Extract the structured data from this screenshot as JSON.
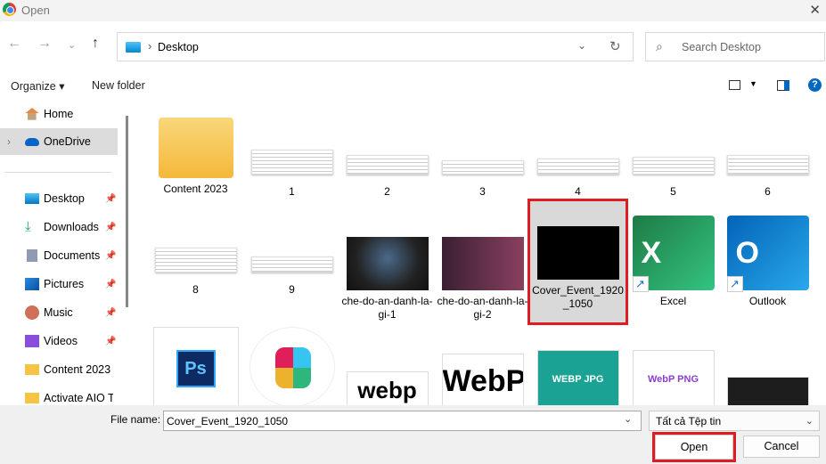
{
  "window": {
    "title": "Open"
  },
  "address": {
    "path": "Desktop",
    "search_placeholder": "Search Desktop"
  },
  "toolbar": {
    "organize": "Organize ▾",
    "new_folder": "New folder"
  },
  "sidebar": {
    "items": [
      {
        "label": "Home",
        "icon": "home-icon"
      },
      {
        "label": "OneDrive",
        "icon": "cloud-icon",
        "selected": true
      },
      {
        "label": "Desktop",
        "icon": "desktop-icon",
        "pinned": true
      },
      {
        "label": "Downloads",
        "icon": "download-icon",
        "pinned": true
      },
      {
        "label": "Documents",
        "icon": "document-icon",
        "pinned": true
      },
      {
        "label": "Pictures",
        "icon": "pictures-icon",
        "pinned": true
      },
      {
        "label": "Music",
        "icon": "music-icon",
        "pinned": true
      },
      {
        "label": "Videos",
        "icon": "videos-icon",
        "pinned": true
      },
      {
        "label": "Content 2023",
        "icon": "folder-icon"
      },
      {
        "label": "Activate AIO Too",
        "icon": "folder-icon"
      }
    ]
  },
  "files": [
    {
      "name": "Content 2023",
      "type": "folder"
    },
    {
      "name": "1",
      "type": "doc"
    },
    {
      "name": "2",
      "type": "doc"
    },
    {
      "name": "3",
      "type": "doc"
    },
    {
      "name": "4",
      "type": "doc"
    },
    {
      "name": "5",
      "type": "doc"
    },
    {
      "name": "6",
      "type": "doc"
    },
    {
      "name": "8",
      "type": "doc"
    },
    {
      "name": "9",
      "type": "doc"
    },
    {
      "name": "che-do-an-danh-la-gi-1",
      "type": "image"
    },
    {
      "name": "che-do-an-danh-la-gi-2",
      "type": "image"
    },
    {
      "name": "Cover_Event_1920_1050",
      "type": "image",
      "selected": true
    },
    {
      "name": "Excel",
      "type": "shortcut",
      "letter": "X"
    },
    {
      "name": "Outlook",
      "type": "shortcut",
      "letter": "O"
    },
    {
      "name": "",
      "type": "app",
      "letter": "Ps"
    },
    {
      "name": "",
      "type": "app"
    },
    {
      "name": "",
      "type": "image",
      "letter": "webp"
    },
    {
      "name": "",
      "type": "image",
      "letter": "WebP"
    },
    {
      "name": "",
      "type": "image",
      "letter": "WEBP JPG"
    },
    {
      "name": "",
      "type": "image",
      "letter": "WebP PNG"
    },
    {
      "name": "",
      "type": "image"
    }
  ],
  "bottom": {
    "file_name_label": "File name:",
    "file_name_value": "Cover_Event_1920_1050",
    "filter": "Tất cả Tệp tin",
    "open": "Open",
    "cancel": "Cancel"
  },
  "colors": {
    "highlight": "#e01b24",
    "accent": "#0067c0"
  }
}
